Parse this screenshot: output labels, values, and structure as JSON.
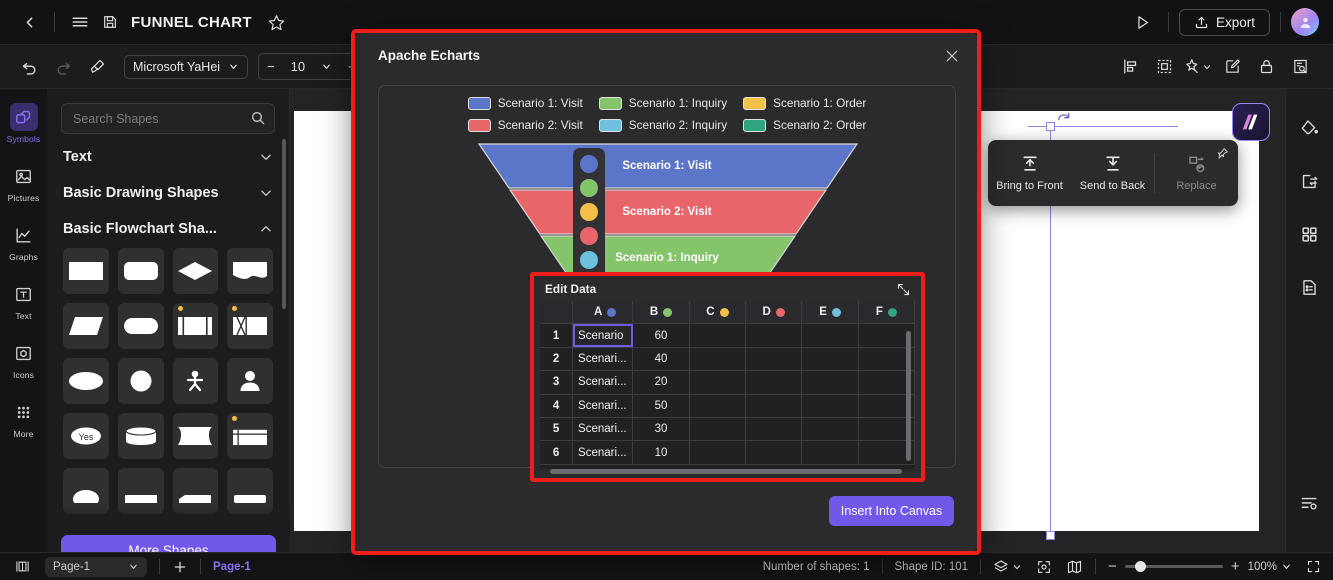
{
  "topbar": {
    "back_icon": "chevron-left-icon",
    "menu_icon": "hamburger-menu-icon",
    "save_icon": "save-floppy-icon",
    "title": "FUNNEL CHART",
    "favorite_icon": "star-icon",
    "present_icon": "play-triangle-icon",
    "export_label": "Export",
    "export_icon": "upload-icon",
    "avatar_icon": "user-avatar"
  },
  "toolbar": {
    "undo_icon": "undo-icon",
    "redo_icon": "redo-icon",
    "format_painter_icon": "format-painter-icon",
    "font_family": "Microsoft YaHei",
    "font_size": "10",
    "decrease_label": "−",
    "increase_label": "+",
    "align_icon": "align-icon",
    "position_icon": "position-icon",
    "effects_icon": "magic-wand-icon",
    "edit_icon": "edit-pencil-icon",
    "lock_icon": "lock-icon",
    "inspect_icon": "inspect-icon"
  },
  "rail": {
    "items": [
      {
        "label": "Symbols",
        "icon": "symbols-icon",
        "active": true
      },
      {
        "label": "Pictures",
        "icon": "picture-icon",
        "active": false
      },
      {
        "label": "Graphs",
        "icon": "graph-line-icon",
        "active": false
      },
      {
        "label": "Text",
        "icon": "text-box-icon",
        "active": false
      },
      {
        "label": "Icons",
        "icon": "icons-icon",
        "active": false
      },
      {
        "label": "More",
        "icon": "grid-dots-icon",
        "active": false
      }
    ]
  },
  "panel": {
    "search_placeholder": "Search Shapes",
    "search_icon": "search-icon",
    "sections": [
      {
        "title": "Text",
        "expanded": false
      },
      {
        "title": "Basic Drawing Shapes",
        "expanded": false
      },
      {
        "title": "Basic Flowchart Sha...",
        "expanded": true
      }
    ],
    "more_shapes_label": "More Shapes"
  },
  "canvas": {
    "context_menu": {
      "bring_to_front": "Bring to Front",
      "send_to_back": "Send to Back",
      "replace": "Replace",
      "pin_icon": "pin-icon"
    }
  },
  "right_rail": {
    "items": [
      {
        "icon": "fill-bucket-icon"
      },
      {
        "icon": "swap-replace-icon"
      },
      {
        "icon": "grid-four-icon"
      },
      {
        "icon": "document-list-icon"
      }
    ],
    "bottom_icon": "settings-sliders-icon"
  },
  "status": {
    "page_layout_icon": "page-layout-icon",
    "page_select": "Page-1",
    "add_page_icon": "plus-icon",
    "active_tab": "Page-1",
    "shapes_count": "Number of shapes: 1",
    "shape_id": "Shape ID: 101",
    "layers_icon": "layers-icon",
    "focus_icon": "focus-icon",
    "map_icon": "map-icon",
    "zoom_minus": "−",
    "zoom_plus": "+",
    "zoom_level": "100%",
    "fullscreen_icon": "fullscreen-icon"
  },
  "modal": {
    "title": "Apache Echarts",
    "close_icon": "close-x-icon",
    "insert_label": "Insert Into Canvas",
    "palette": [
      "#5b76c8",
      "#84c46a",
      "#f3c14a",
      "#e8656a",
      "#6fc0de",
      "#2fa480"
    ],
    "edit_chart_icon": "edit-chart-icon",
    "chart_settings_icon": "chart-settings-icon"
  },
  "chart_data": {
    "type": "funnel",
    "title": "",
    "legend_position": "top",
    "legend": [
      {
        "name": "Scenario 1: Visit",
        "color": "#5b76c8"
      },
      {
        "name": "Scenario 1: Inquiry",
        "color": "#84c46a"
      },
      {
        "name": "Scenario 1: Order",
        "color": "#f3c14a"
      },
      {
        "name": "Scenario 2: Visit",
        "color": "#e8656a"
      },
      {
        "name": "Scenario 2: Inquiry",
        "color": "#6fc0de"
      },
      {
        "name": "Scenario 2: Order",
        "color": "#2fa480"
      }
    ],
    "categories": [
      "Scenario 1: Visit",
      "Scenario 2: Visit",
      "Scenario 1: Inquiry",
      "Scenario 2: Inquiry",
      "Scenario 1: Order",
      "Scenario 2: Order"
    ],
    "values": [
      60,
      50,
      40,
      30,
      20,
      10
    ],
    "visible_segments": [
      {
        "label": "Scenario 1: Visit",
        "value": 60,
        "color": "#5b76c8"
      },
      {
        "label": "Scenario 2: Visit",
        "value": 50,
        "color": "#e8656a"
      },
      {
        "label": "Scenario 1: Inquiry",
        "value": 40,
        "color": "#84c46a"
      }
    ]
  },
  "edit_data": {
    "title": "Edit Data",
    "expand_icon": "expand-diagonal-icon",
    "columns": [
      {
        "label": "A",
        "color": "#5b76c8"
      },
      {
        "label": "B",
        "color": "#84c46a"
      },
      {
        "label": "C",
        "color": "#f3c14a"
      },
      {
        "label": "D",
        "color": "#e8656a"
      },
      {
        "label": "E",
        "color": "#6fc0de"
      },
      {
        "label": "F",
        "color": "#2fa480"
      }
    ],
    "rows": [
      {
        "index": "1",
        "a": "Scenario",
        "b": "60",
        "c": "",
        "d": "",
        "e": "",
        "f": "",
        "selected": true
      },
      {
        "index": "2",
        "a": "Scenari...",
        "b": "40",
        "c": "",
        "d": "",
        "e": "",
        "f": "",
        "selected": false
      },
      {
        "index": "3",
        "a": "Scenari...",
        "b": "20",
        "c": "",
        "d": "",
        "e": "",
        "f": "",
        "selected": false
      },
      {
        "index": "4",
        "a": "Scenari...",
        "b": "50",
        "c": "",
        "d": "",
        "e": "",
        "f": "",
        "selected": false
      },
      {
        "index": "5",
        "a": "Scenari...",
        "b": "30",
        "c": "",
        "d": "",
        "e": "",
        "f": "",
        "selected": false
      },
      {
        "index": "6",
        "a": "Scenari...",
        "b": "10",
        "c": "",
        "d": "",
        "e": "",
        "f": "",
        "selected": false
      }
    ]
  }
}
